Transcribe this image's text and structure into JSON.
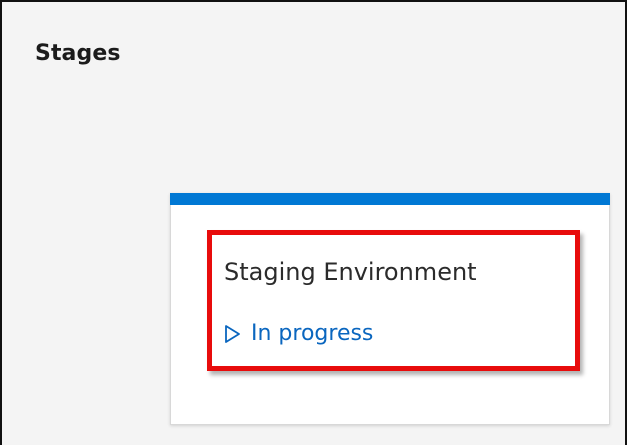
{
  "stages_panel": {
    "title": "Stages"
  },
  "stage_card": {
    "name": "Staging Environment",
    "status": {
      "label": "In progress",
      "icon": "play-outline-icon",
      "color": "#0a66bf"
    },
    "accent_color": "#0078d4",
    "highlight_color": "#e80c0c"
  }
}
